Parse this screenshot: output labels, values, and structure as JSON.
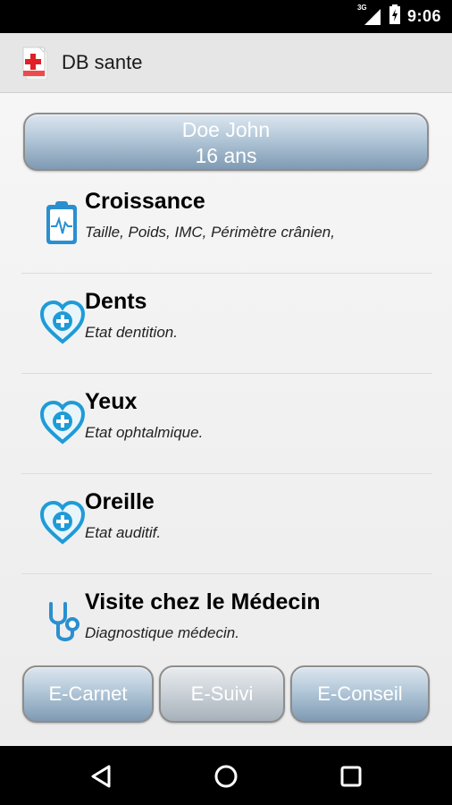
{
  "status_bar": {
    "network": "3G",
    "time": "9:06"
  },
  "app": {
    "title": "DB sante"
  },
  "patient": {
    "name": "Doe John",
    "age": "16 ans"
  },
  "menu": [
    {
      "title": "Croissance",
      "subtitle": "Taille, Poids, IMC, Périmètre crânien,",
      "icon": "clipboard-heartbeat-icon"
    },
    {
      "title": "Dents",
      "subtitle": "Etat dentition.",
      "icon": "heart-plus-icon"
    },
    {
      "title": "Yeux",
      "subtitle": "Etat ophtalmique.",
      "icon": "heart-plus-icon"
    },
    {
      "title": "Oreille",
      "subtitle": "Etat auditif.",
      "icon": "heart-plus-icon"
    },
    {
      "title": "Visite chez le Médecin",
      "subtitle": "Diagnostique médecin.",
      "icon": "stethoscope-icon"
    }
  ],
  "bottom_tabs": [
    {
      "label": "E-Carnet",
      "selected": false
    },
    {
      "label": "E-Suivi",
      "selected": true
    },
    {
      "label": "E-Conseil",
      "selected": false
    }
  ],
  "colors": {
    "accent_blue": "#1f9bd7",
    "button_dark": "#7f9ab3",
    "button_light": "#dce6ef"
  }
}
